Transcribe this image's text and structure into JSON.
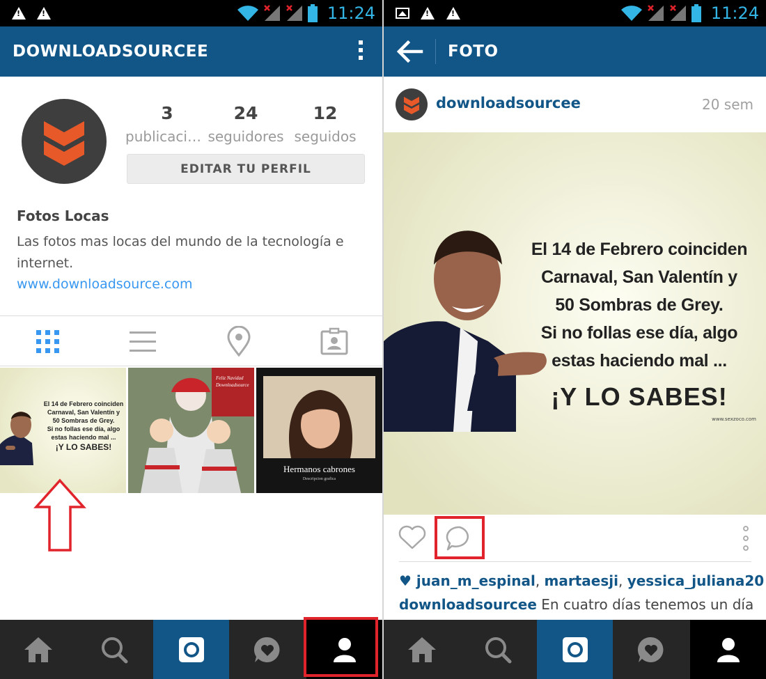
{
  "status_bar": {
    "time": "11:24"
  },
  "profile": {
    "app_bar_title": "DOWNLOADSOURCEE",
    "stats": [
      {
        "value": "3",
        "label": "publicacio…"
      },
      {
        "value": "24",
        "label": "seguidores"
      },
      {
        "value": "12",
        "label": "seguidos"
      }
    ],
    "edit_button": "EDITAR TU PERFIL",
    "name": "Fotos Locas",
    "bio": "Las fotos mas locas del mundo de la tecnología e internet.",
    "website": "www.downloadsource.com",
    "thumbnails": [
      {
        "lines": [
          "El 14 de Febrero coinciden",
          "Carnaval, San Valentín y",
          "50 Sombras de Grey.",
          "Si no follas ese día, algo",
          "estas haciendo mal ..."
        ],
        "headline": "¡Y LO SABES!"
      },
      {
        "caption": "Feliz Navidad",
        "sub": "Downloadsource"
      },
      {
        "caption": "Hermanos cabrones",
        "sub": "Descripcion grafica"
      }
    ]
  },
  "photo": {
    "app_bar_title": "FOTO",
    "username": "downloadsourcee",
    "time_ago": "20 sem",
    "image_lines": [
      "El 14 de Febrero coinciden",
      "Carnaval, San Valentín y",
      "50 Sombras de Grey.",
      "Si no follas ese día, algo",
      "estas haciendo mal ..."
    ],
    "image_headline": "¡Y LO SABES!",
    "image_credit": "www.sexzoco.com",
    "likers": [
      "juan_m_espinal",
      "martaesji",
      "yessica_juliana20"
    ],
    "liker_sep": ", ",
    "caption_user": "downloadsourcee",
    "caption_text": "En cuatro días tenemos un día"
  },
  "colors": {
    "brand_blue": "#125688",
    "highlight_red": "#e1232b",
    "logo_orange": "#e8592a"
  },
  "icons": [
    "home-icon",
    "search-icon",
    "camera-icon",
    "activity-heart-icon",
    "profile-icon",
    "grid-icon",
    "list-icon",
    "location-icon",
    "tagged-icon",
    "heart-icon",
    "comment-icon",
    "more-icon",
    "back-arrow-icon",
    "menu-icon"
  ]
}
